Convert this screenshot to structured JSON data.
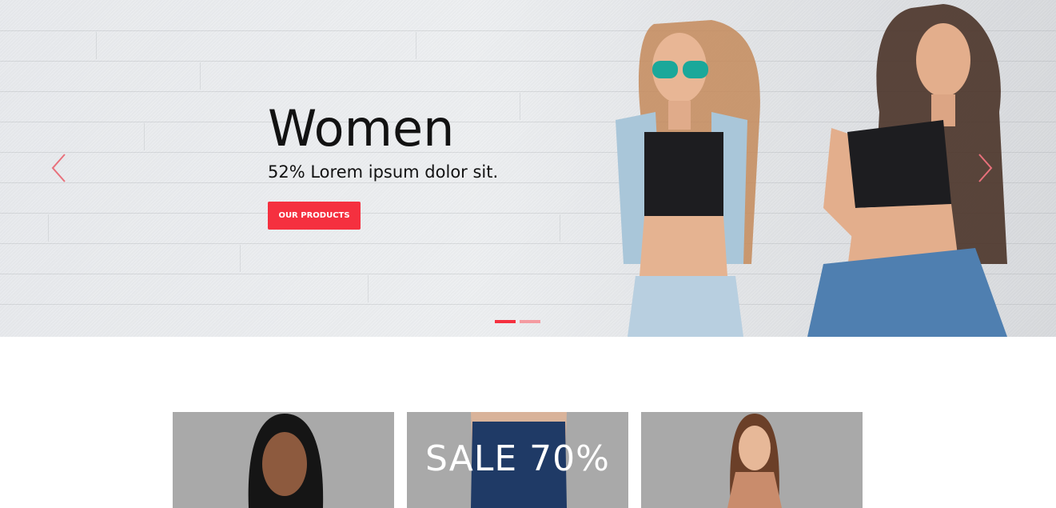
{
  "slider": {
    "title": "Women",
    "subtitle": "52% Lorem ipsum dolor sit.",
    "button_label": "OUR PRODUCTS",
    "prev_icon": "chevron-left-icon",
    "next_icon": "chevron-right-icon",
    "slide_count": 2,
    "active_slide": 1
  },
  "colors": {
    "accent": "#f5303f",
    "accent_light": "#f49ba1",
    "title": "#121212"
  },
  "promo_cards": [
    {
      "name": "card-woman-portrait",
      "text": ""
    },
    {
      "name": "card-sale",
      "text": "SALE 70%"
    },
    {
      "name": "card-woman-model",
      "text": ""
    }
  ]
}
